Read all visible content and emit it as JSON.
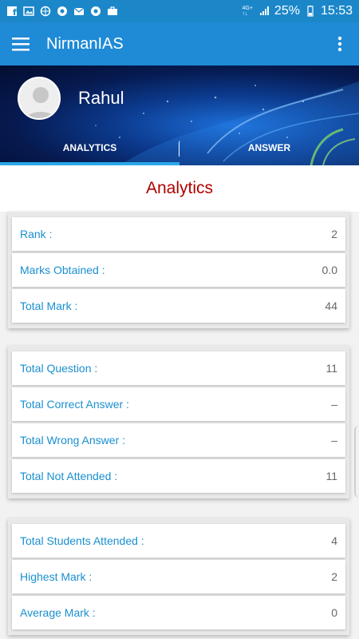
{
  "status_bar": {
    "left_icons": [
      "facebook-icon",
      "gallery-icon",
      "browser-icon",
      "chrome-icon",
      "mail-icon",
      "chrome-icon",
      "briefcase-icon"
    ],
    "network_top": "4G+",
    "network_bottom": "↑↓",
    "battery": "25%",
    "time": "15:53"
  },
  "app_bar": {
    "title": "NirmanIAS"
  },
  "profile": {
    "name": "Rahul"
  },
  "tabs": [
    {
      "label": "ANALYTICS",
      "active": true
    },
    {
      "label": "ANSWER",
      "active": false
    }
  ],
  "analytics": {
    "title": "Analytics",
    "groups": [
      {
        "rows": [
          {
            "label": "Rank :",
            "value": "2"
          },
          {
            "label": "Marks Obtained :",
            "value": "0.0"
          },
          {
            "label": "Total Mark :",
            "value": "44"
          }
        ]
      },
      {
        "rows": [
          {
            "label": "Total Question :",
            "value": "11"
          },
          {
            "label": "Total Correct Answer :",
            "value": "–"
          },
          {
            "label": "Total Wrong Answer :",
            "value": "–"
          },
          {
            "label": "Total Not Attended :",
            "value": "11"
          }
        ]
      },
      {
        "rows": [
          {
            "label": "Total Students Attended :",
            "value": "4"
          },
          {
            "label": "Highest Mark :",
            "value": "2"
          },
          {
            "label": "Average Mark :",
            "value": "0"
          }
        ]
      }
    ]
  },
  "colors": {
    "status_bar": "#1b87c9",
    "app_bar": "#1f8ad6",
    "label": "#1a8fd0",
    "title": "#b00000",
    "tab_indicator": "#29a7e8"
  }
}
